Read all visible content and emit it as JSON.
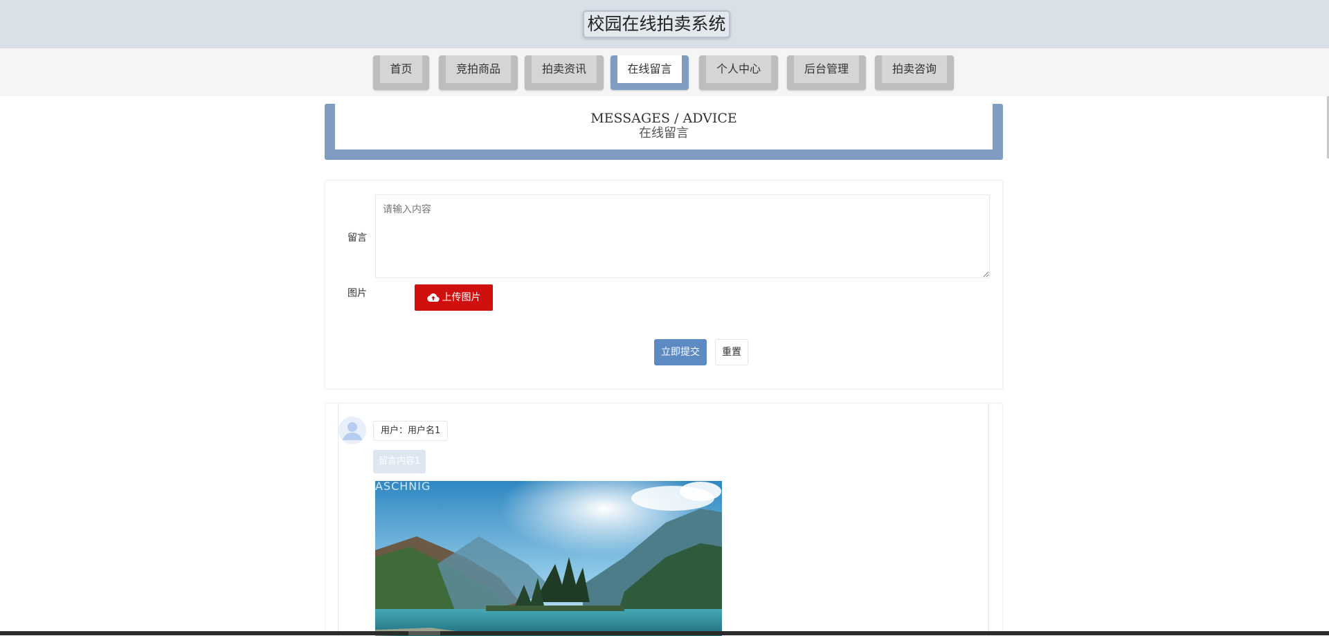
{
  "header": {
    "title": "校园在线拍卖系统"
  },
  "nav": {
    "items": [
      {
        "label": "首页"
      },
      {
        "label": "竞拍商品"
      },
      {
        "label": "拍卖资讯"
      },
      {
        "label": "在线留言",
        "active": true
      },
      {
        "label": "个人中心"
      },
      {
        "label": "后台管理"
      },
      {
        "label": "拍卖咨询"
      }
    ]
  },
  "banner": {
    "title_en": "MESSAGES / ADVICE",
    "title_cn": "在线留言"
  },
  "form": {
    "message_label": "留言",
    "message_placeholder": "请输入内容",
    "image_label": "图片",
    "upload_label": "上传图片",
    "submit_label": "立即提交",
    "reset_label": "重置"
  },
  "messages": [
    {
      "user_text": "用户：用户名1",
      "content": "留言内容1",
      "image_watermark": "ASCHNIG"
    }
  ],
  "colors": {
    "header_bg": "#d9e0e8",
    "accent": "#7f9cc3",
    "upload_button": "#d00f0f",
    "submit_button": "#5e8ac4"
  }
}
